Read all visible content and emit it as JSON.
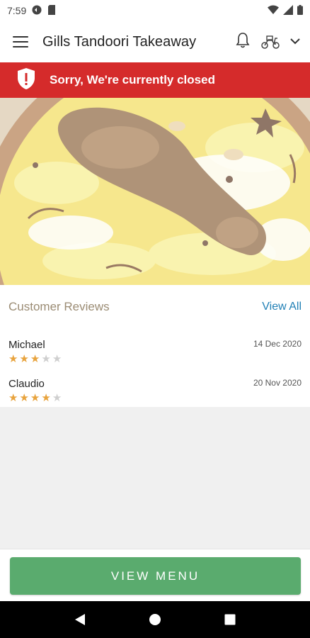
{
  "status_bar": {
    "time": "7:59"
  },
  "app_bar": {
    "title": "Gills Tandoori Takeaway"
  },
  "banner": {
    "text": "Sorry, We're currently closed"
  },
  "reviews": {
    "title": "Customer Reviews",
    "view_all_label": "View All",
    "items": [
      {
        "name": "Michael",
        "date": "14 Dec 2020",
        "rating": 3,
        "max_rating": 5
      },
      {
        "name": "Claudio",
        "date": "20 Nov 2020",
        "rating": 4,
        "max_rating": 5
      }
    ]
  },
  "footer": {
    "menu_button_label": "VIEW MENU"
  },
  "colors": {
    "banner": "#d52b2b",
    "menu_button": "#5aab6e",
    "star_on": "#e8a33d",
    "star_off": "#cfcfcf",
    "link": "#1f7fb5"
  }
}
